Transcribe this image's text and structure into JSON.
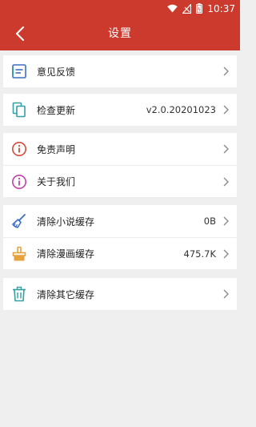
{
  "status_bar": {
    "time": "10:37",
    "icons": [
      "wifi-icon",
      "signal-off-icon",
      "battery-icon"
    ]
  },
  "app_bar": {
    "title": "设置",
    "back_icon": "back-arrow-icon"
  },
  "colors": {
    "primary": "#cc3a2e",
    "background": "#efefef",
    "icon_blue": "#3c6fc4",
    "icon_teal": "#34a0a4",
    "icon_red": "#d44b3c",
    "icon_pink": "#c243a4",
    "icon_orange": "#e6a23c",
    "chevron": "#8a8a8a"
  },
  "groups": [
    {
      "items": [
        {
          "label": "意见反馈",
          "icon": "feedback-icon"
        }
      ]
    },
    {
      "items": [
        {
          "label": "检查更新",
          "icon": "copy-icon",
          "value": "v2.0.20201023"
        }
      ]
    },
    {
      "items": [
        {
          "label": "免责声明",
          "icon": "info-circle-icon"
        },
        {
          "label": "关于我们",
          "icon": "about-icon"
        }
      ]
    },
    {
      "items": [
        {
          "label": "清除小说缓存",
          "icon": "broom-icon",
          "value": "0B"
        },
        {
          "label": "清除漫画缓存",
          "icon": "brush-icon",
          "value": "475.7K"
        }
      ]
    },
    {
      "items": [
        {
          "label": "清除其它缓存",
          "icon": "trash-icon"
        }
      ]
    }
  ]
}
